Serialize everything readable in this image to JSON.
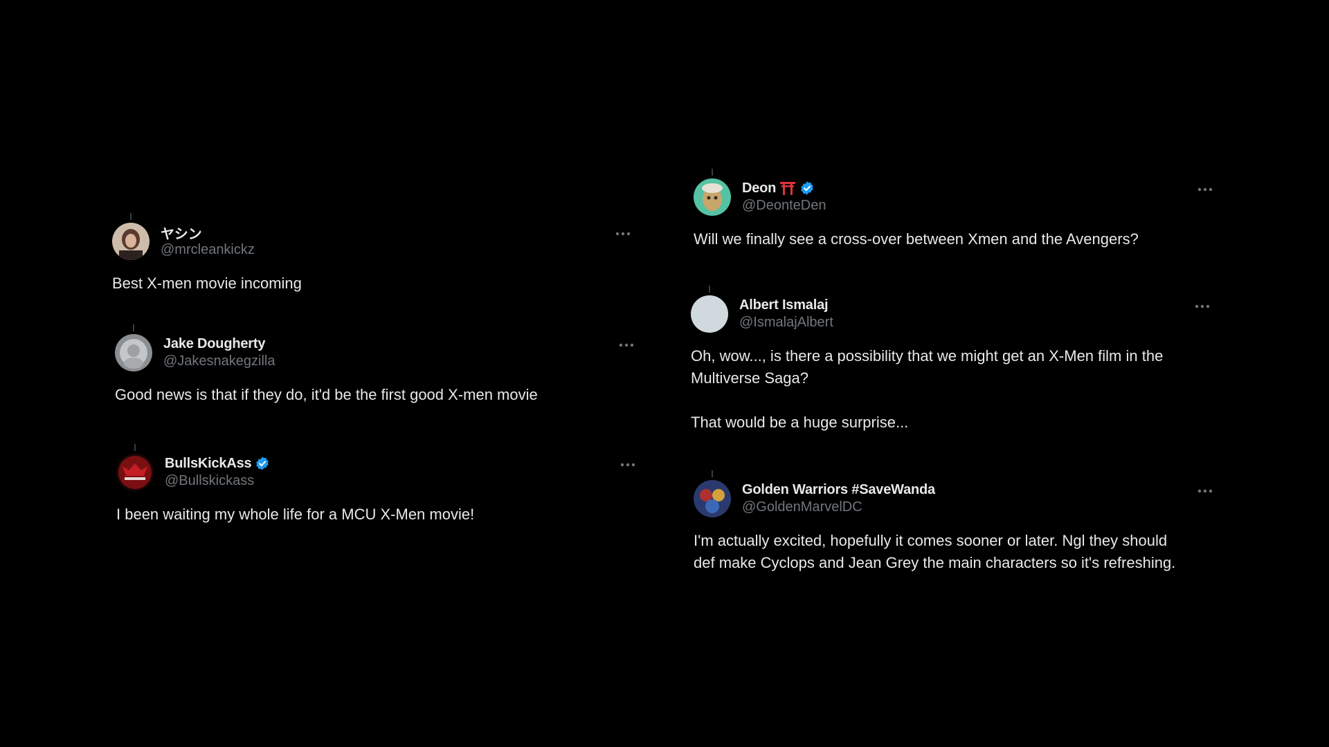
{
  "colors": {
    "background": "#000000",
    "text_primary": "#e7e9ea",
    "text_secondary": "#71767b",
    "verified_blue": "#1d9bf0"
  },
  "icons": {
    "more": "more-horizontal-icon",
    "verified": "verified-badge-icon",
    "torii": "torii-gate-emoji-icon"
  },
  "tweets": [
    {
      "display_name": "ヤシン",
      "handle": "@mrcleankickz",
      "verified": false,
      "text": "Best X-men movie incoming"
    },
    {
      "display_name": "Jake Dougherty",
      "handle": "@Jakesnakegzilla",
      "verified": false,
      "text": "Good news is that if they do, it'd be the first good X-men movie"
    },
    {
      "display_name": "BullsKickAss",
      "handle": "@Bullskickass",
      "verified": true,
      "text": "I been waiting my whole life for a MCU X-Men movie!"
    },
    {
      "display_name": "Deon",
      "handle": "@DeonteDen",
      "verified": true,
      "emoji": "torii",
      "text": "Will we finally see a cross-over between Xmen and the Avengers?"
    },
    {
      "display_name": "Albert Ismalaj",
      "handle": "@IsmalajAlbert",
      "verified": false,
      "text_lines": [
        "Oh, wow..., is there a possibility that we might get an X-Men film in the",
        "Multiverse Saga?",
        "",
        "That would be a huge surprise..."
      ]
    },
    {
      "display_name": "Golden Warriors #SaveWanda",
      "handle": "@GoldenMarvelDC",
      "verified": false,
      "text_lines": [
        "I'm actually excited, hopefully it comes sooner or later. Ngl they should",
        "def make Cyclops and Jean Grey the main characters so it's refreshing."
      ]
    }
  ]
}
